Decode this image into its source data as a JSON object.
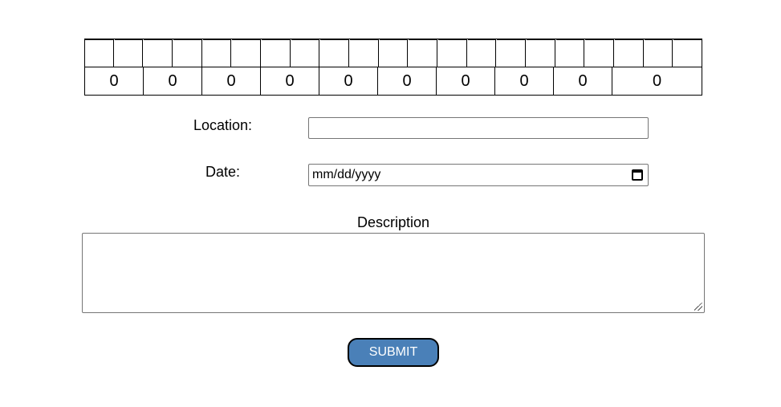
{
  "counter": {
    "top_cell_count": 21,
    "values": [
      "0",
      "0",
      "0",
      "0",
      "0",
      "0",
      "0",
      "0",
      "0",
      "0"
    ]
  },
  "form": {
    "location_label": "Location:",
    "location_value": "",
    "date_label": "Date:",
    "date_placeholder": "mm/dd/yyyy",
    "description_label": "Description",
    "description_value": "",
    "submit_label": "SUBMIT"
  },
  "colors": {
    "submit_bg": "#4a80b8",
    "border": "#000000",
    "input_border": "#767676"
  },
  "icons": {
    "date_field": "calendar-icon",
    "textarea": "resize-grip-icon"
  }
}
